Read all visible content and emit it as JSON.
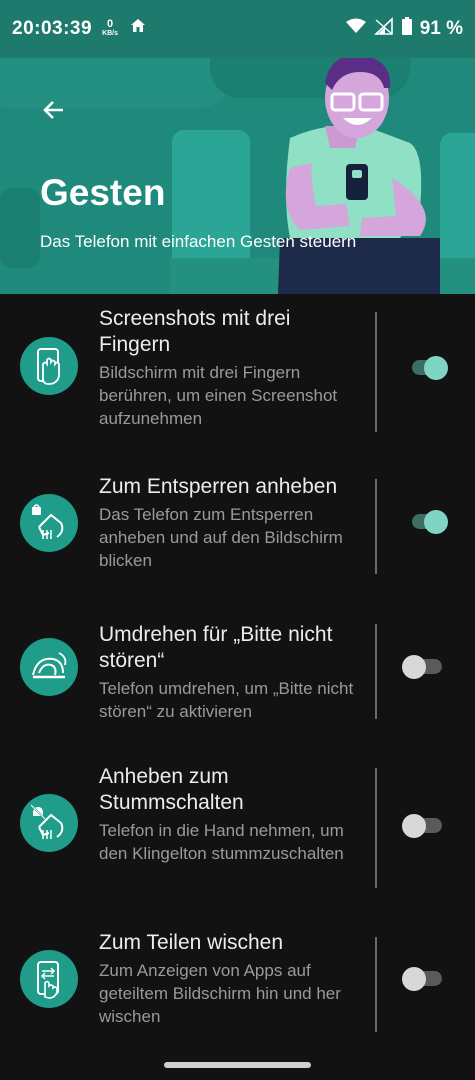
{
  "status_bar": {
    "time": "20:03:39",
    "net_speed": "0",
    "net_unit": "KB/s",
    "battery": "91 %"
  },
  "header": {
    "title": "Gesten",
    "subtitle": "Das Telefon mit einfachen Gesten steuern"
  },
  "gestures": [
    {
      "title": "Screenshots mit drei Fingern",
      "description": "Bildschirm mit drei Fingern berühren, um einen Screenshot aufzunehmen",
      "enabled": true,
      "icon": "three-finger-screenshot-icon"
    },
    {
      "title": "Zum Entsperren anheben",
      "description": "Das Telefon zum Entsperren anheben und auf den Bildschirm blicken",
      "enabled": true,
      "icon": "lift-unlock-icon"
    },
    {
      "title": "Umdrehen für „Bitte nicht stören“",
      "description": "Telefon umdrehen, um „Bitte nicht stören“ zu aktivieren",
      "enabled": false,
      "icon": "flip-dnd-icon"
    },
    {
      "title": "Anheben zum Stummschalten",
      "description": "Telefon in die Hand nehmen, um den Klingelton stummzuschalten",
      "enabled": false,
      "icon": "lift-mute-icon"
    },
    {
      "title": "Zum Teilen wischen",
      "description": "Zum Anzeigen von Apps auf geteiltem Bildschirm hin und her wischen",
      "enabled": false,
      "icon": "swipe-split-icon"
    }
  ],
  "colors": {
    "accent": "#1f9c8a",
    "header_bg": "#1f8a7b",
    "toggle_on": "#80d4c4",
    "background": "#121212"
  }
}
